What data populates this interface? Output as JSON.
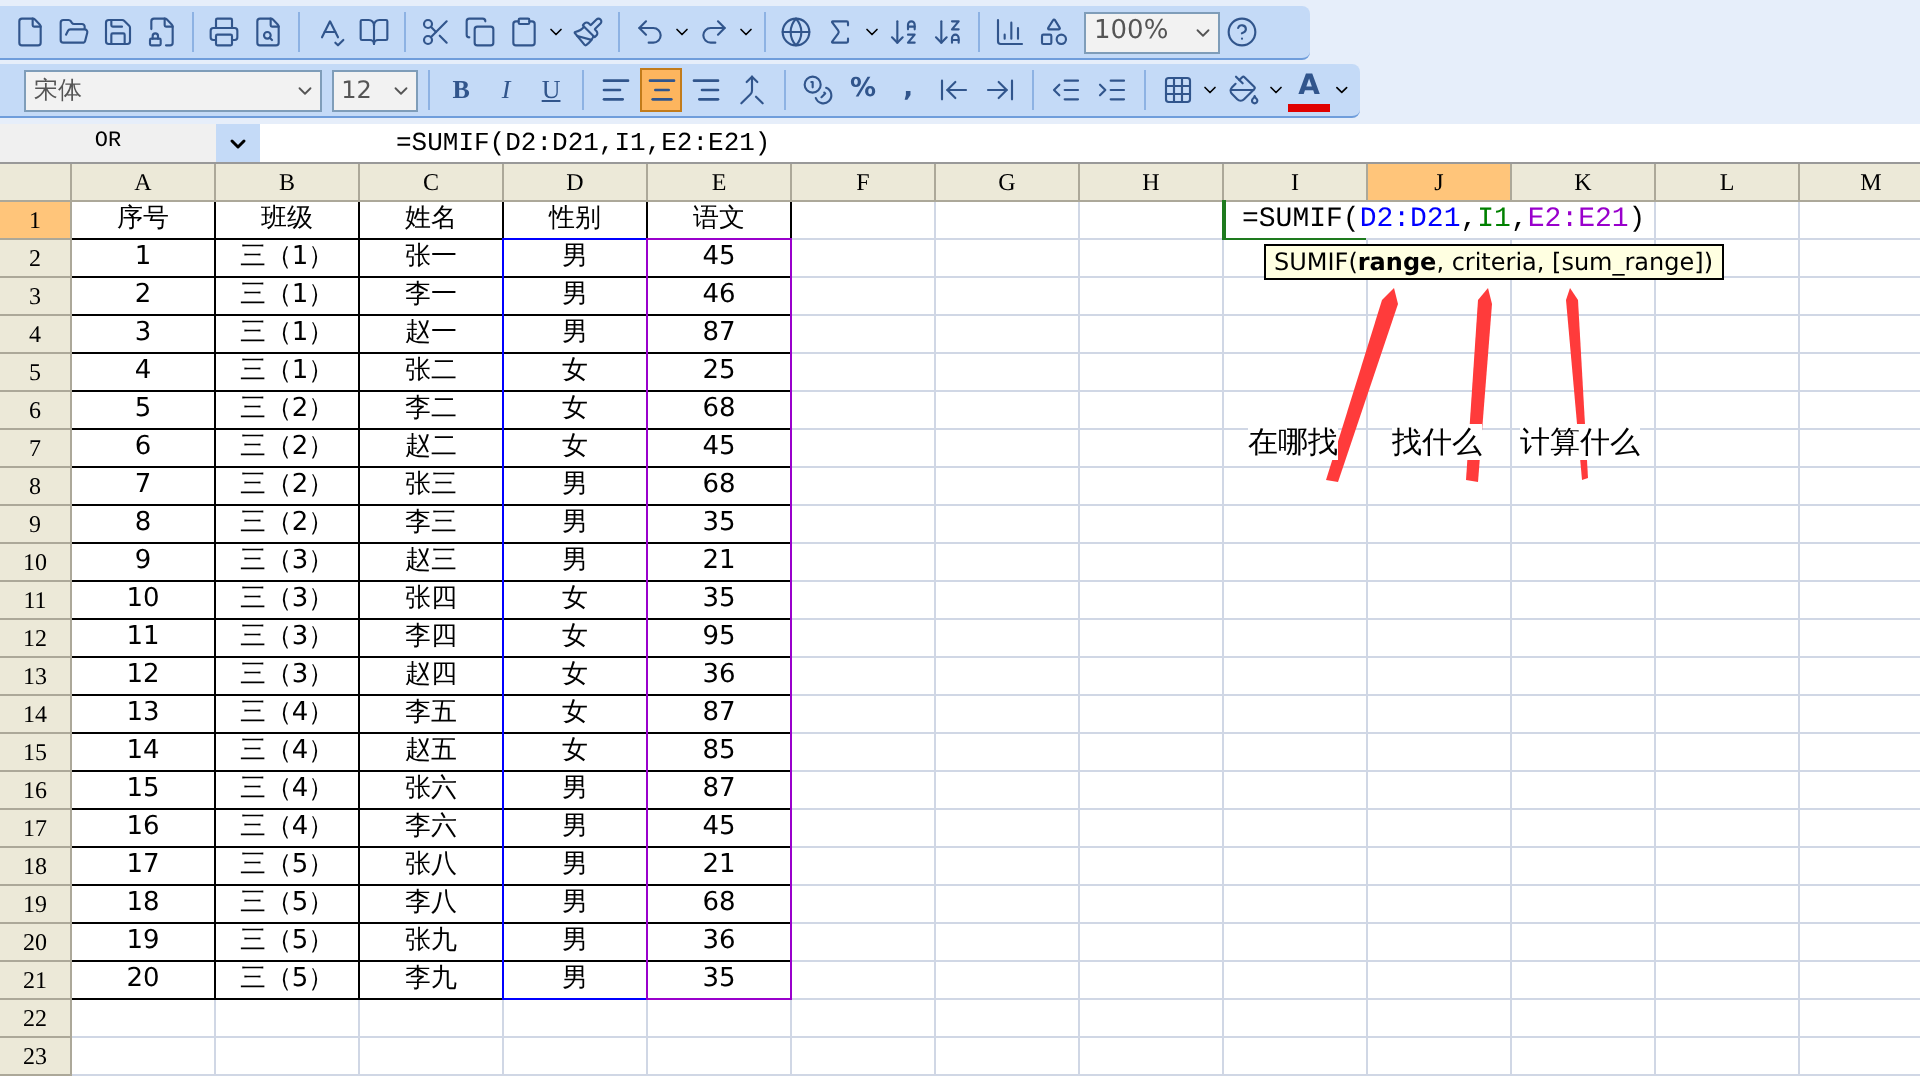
{
  "toolbar": {
    "zoom": "100%"
  },
  "format_bar": {
    "font": "宋体",
    "size": "12",
    "style_buttons": [
      {
        "label": "B",
        "kind": "bold"
      },
      {
        "label": "I",
        "kind": "italic"
      },
      {
        "label": "U",
        "kind": "underline"
      }
    ],
    "alignment": [
      {
        "selected": false
      },
      {
        "selected": true
      },
      {
        "selected": false
      }
    ],
    "number_buttons": [
      {
        "label": "%"
      },
      {
        "label": ","
      }
    ],
    "font_color_label": "A"
  },
  "formula_bar": {
    "name_box": "OR",
    "formula": "=SUMIF(D2:D21,I1,E2:E21)"
  },
  "columns": [
    {
      "label": "A",
      "selected": false
    },
    {
      "label": "B",
      "selected": false
    },
    {
      "label": "C",
      "selected": false
    },
    {
      "label": "D",
      "selected": false
    },
    {
      "label": "E",
      "selected": false
    },
    {
      "label": "F",
      "selected": false
    },
    {
      "label": "G",
      "selected": false
    },
    {
      "label": "H",
      "selected": false
    },
    {
      "label": "I",
      "selected": false
    },
    {
      "label": "J",
      "selected": true
    },
    {
      "label": "K",
      "selected": false
    },
    {
      "label": "L",
      "selected": false
    },
    {
      "label": "M",
      "selected": false
    }
  ],
  "rows": [
    {
      "label": "1",
      "selected": true,
      "cells": [
        "序号",
        "班级",
        "姓名",
        "性别",
        "语文"
      ]
    },
    {
      "label": "2",
      "selected": false,
      "cells": [
        "1",
        "三（1）",
        "张一",
        "男",
        "45"
      ]
    },
    {
      "label": "3",
      "selected": false,
      "cells": [
        "2",
        "三（1）",
        "李一",
        "男",
        "46"
      ]
    },
    {
      "label": "4",
      "selected": false,
      "cells": [
        "3",
        "三（1）",
        "赵一",
        "男",
        "87"
      ]
    },
    {
      "label": "5",
      "selected": false,
      "cells": [
        "4",
        "三（1）",
        "张二",
        "女",
        "25"
      ]
    },
    {
      "label": "6",
      "selected": false,
      "cells": [
        "5",
        "三（2）",
        "李二",
        "女",
        "68"
      ]
    },
    {
      "label": "7",
      "selected": false,
      "cells": [
        "6",
        "三（2）",
        "赵二",
        "女",
        "45"
      ]
    },
    {
      "label": "8",
      "selected": false,
      "cells": [
        "7",
        "三（2）",
        "张三",
        "男",
        "68"
      ]
    },
    {
      "label": "9",
      "selected": false,
      "cells": [
        "8",
        "三（2）",
        "李三",
        "男",
        "35"
      ]
    },
    {
      "label": "10",
      "selected": false,
      "cells": [
        "9",
        "三（3）",
        "赵三",
        "男",
        "21"
      ]
    },
    {
      "label": "11",
      "selected": false,
      "cells": [
        "10",
        "三（3）",
        "张四",
        "女",
        "35"
      ]
    },
    {
      "label": "12",
      "selected": false,
      "cells": [
        "11",
        "三（3）",
        "李四",
        "女",
        "95"
      ]
    },
    {
      "label": "13",
      "selected": false,
      "cells": [
        "12",
        "三（3）",
        "赵四",
        "女",
        "36"
      ]
    },
    {
      "label": "14",
      "selected": false,
      "cells": [
        "13",
        "三（4）",
        "李五",
        "女",
        "87"
      ]
    },
    {
      "label": "15",
      "selected": false,
      "cells": [
        "14",
        "三（4）",
        "赵五",
        "女",
        "85"
      ]
    },
    {
      "label": "16",
      "selected": false,
      "cells": [
        "15",
        "三（4）",
        "张六",
        "男",
        "87"
      ]
    },
    {
      "label": "17",
      "selected": false,
      "cells": [
        "16",
        "三（4）",
        "李六",
        "男",
        "45"
      ]
    },
    {
      "label": "18",
      "selected": false,
      "cells": [
        "17",
        "三（5）",
        "张八",
        "男",
        "21"
      ]
    },
    {
      "label": "19",
      "selected": false,
      "cells": [
        "18",
        "三（5）",
        "李八",
        "男",
        "68"
      ]
    },
    {
      "label": "20",
      "selected": false,
      "cells": [
        "19",
        "三（5）",
        "张九",
        "男",
        "36"
      ]
    },
    {
      "label": "21",
      "selected": false,
      "cells": [
        "20",
        "三（5）",
        "李九",
        "男",
        "35"
      ]
    },
    {
      "label": "22",
      "selected": false,
      "cells": []
    },
    {
      "label": "23",
      "selected": false,
      "cells": []
    }
  ],
  "cell_edit": {
    "parts": [
      {
        "text": "=SUMIF(",
        "kind": "plain",
        "color": "#000000"
      },
      {
        "text": "D2:D21",
        "kind": "range",
        "color": "#0000ff"
      },
      {
        "text": ",",
        "kind": "plain",
        "color": "#000000"
      },
      {
        "text": "I1",
        "kind": "range",
        "color": "#008000"
      },
      {
        "text": ",",
        "kind": "plain",
        "color": "#000000"
      },
      {
        "text": "E2:E21",
        "kind": "range",
        "color": "#9900cc"
      },
      {
        "text": ")",
        "kind": "plain",
        "color": "#000000"
      }
    ],
    "tooltip": "SUMIF(**range**, criteria, [sum_range])"
  },
  "annotations": [
    "在哪找",
    "找什么",
    "计算什么"
  ]
}
